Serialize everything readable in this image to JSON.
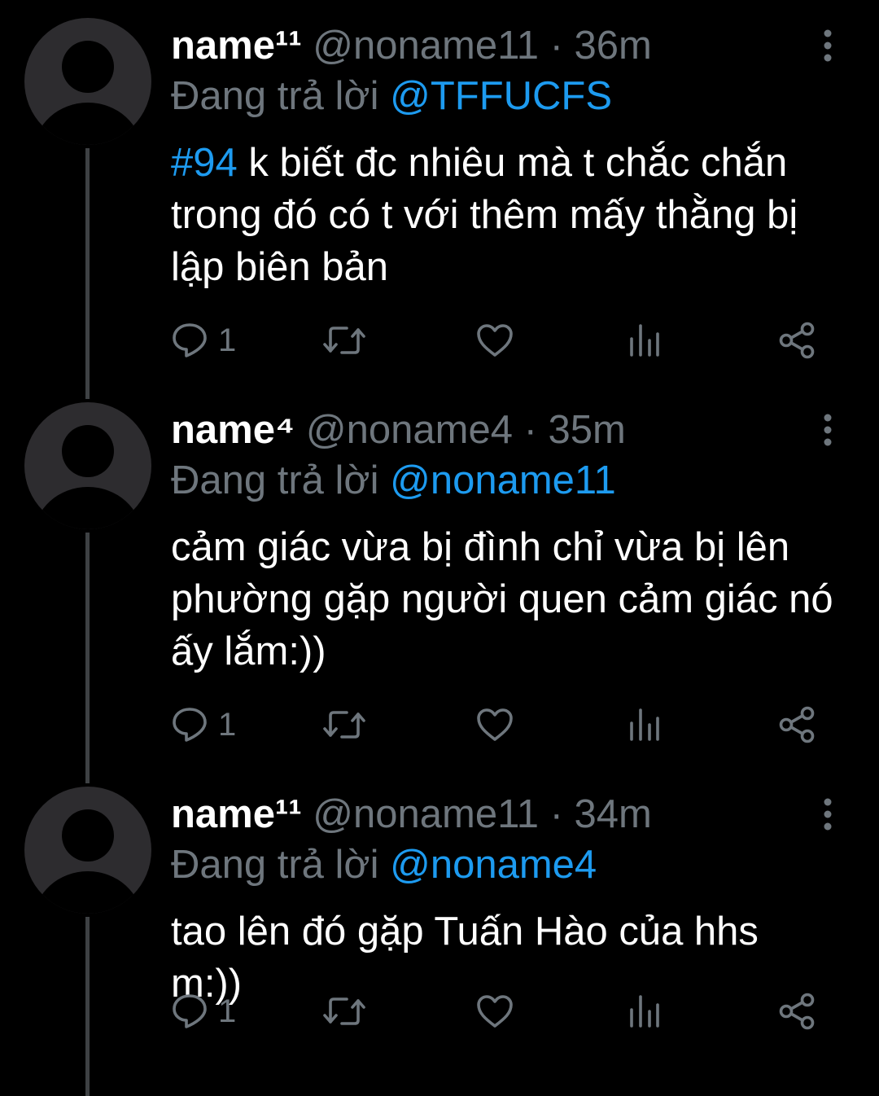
{
  "tweets": [
    {
      "display_name": "name¹¹",
      "handle": "@noname11",
      "time": "36m",
      "reply_prefix": "Đang trả lời",
      "reply_to": "@TFFUCFS",
      "hashtag": "#94",
      "text": " k biết đc nhiêu mà t chắc chắn trong đó có t với thêm mấy thằng bị lập biên bản",
      "reply_count": "1"
    },
    {
      "display_name": "name⁴",
      "handle": "@noname4",
      "time": "35m",
      "reply_prefix": "Đang trả lời",
      "reply_to": "@noname11",
      "hashtag": "",
      "text": "cảm giác vừa bị đình chỉ vừa bị lên phường gặp người quen cảm giác nó ấy lắm:))",
      "reply_count": "1"
    },
    {
      "display_name": "name¹¹",
      "handle": "@noname11",
      "time": "34m",
      "reply_prefix": "Đang trả lời",
      "reply_to": "@noname4",
      "hashtag": "",
      "text": "tao lên đó gặp Tuấn Hào của hhs m:))",
      "reply_count": "1"
    }
  ],
  "separator": "·",
  "icons": {
    "avatar": "default-avatar",
    "more": "more-vertical-icon",
    "reply": "reply-icon",
    "retweet": "retweet-icon",
    "like": "heart-icon",
    "stats": "analytics-icon",
    "share": "share-icon"
  },
  "colors": {
    "background": "#000000",
    "text": "#ffffff",
    "muted": "#6e767d",
    "accent": "#1d9bf0",
    "thread_line": "#3e4144",
    "avatar_bg": "#2d2c2f"
  }
}
